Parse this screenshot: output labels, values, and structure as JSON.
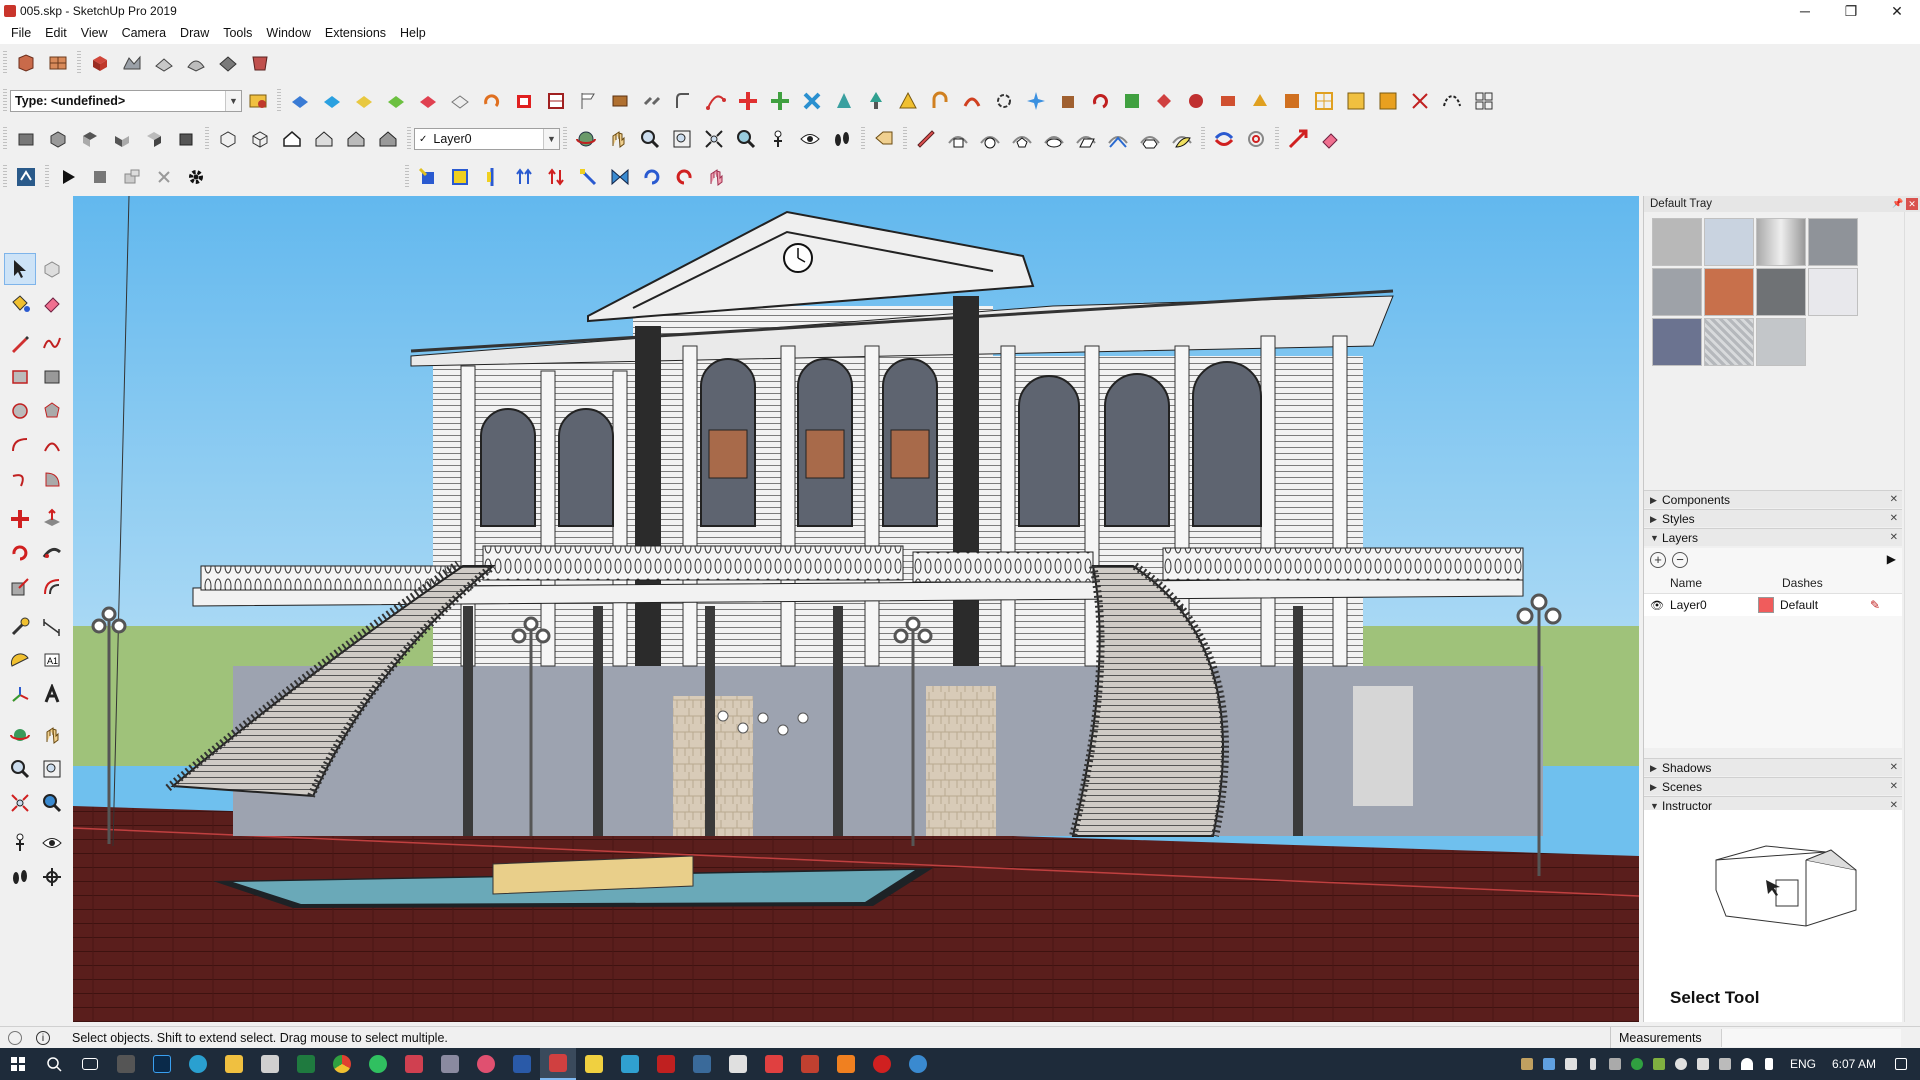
{
  "window": {
    "title": "005.skp - SketchUp Pro 2019",
    "minimize": "─",
    "restore": "❐",
    "close": "✕"
  },
  "menu": [
    "File",
    "Edit",
    "View",
    "Camera",
    "Draw",
    "Tools",
    "Window",
    "Extensions",
    "Help"
  ],
  "toolbar": {
    "type_combo_value": "Type: <undefined>",
    "layer_combo_check": "✓",
    "layer_combo_value": "Layer0"
  },
  "tray": {
    "title": "Default Tray",
    "swatch_colors": [
      "#b8b8b8",
      "#c9d3e0",
      "#d9d9d9",
      "#8f9399",
      "#9ea2a8",
      "#c8704b",
      "#6f7275",
      "#e8e8ec",
      "#6b7390",
      "#b5b8bc",
      "#c3c6c9"
    ],
    "panels": {
      "components": "Components",
      "styles": "Styles",
      "layers": "Layers",
      "shadows": "Shadows",
      "scenes": "Scenes",
      "instructor": "Instructor"
    },
    "layers": {
      "col_name": "Name",
      "col_dashes": "Dashes",
      "rows": [
        {
          "name": "Layer0",
          "color": "#f05c5c",
          "dashes": "Default"
        }
      ]
    },
    "instructor_title": "Select Tool"
  },
  "status": {
    "message": "Select objects. Shift to extend select. Drag mouse to select multiple.",
    "measurements_label": "Measurements"
  },
  "taskbar": {
    "lang": "ENG",
    "time": "6:07 AM"
  }
}
